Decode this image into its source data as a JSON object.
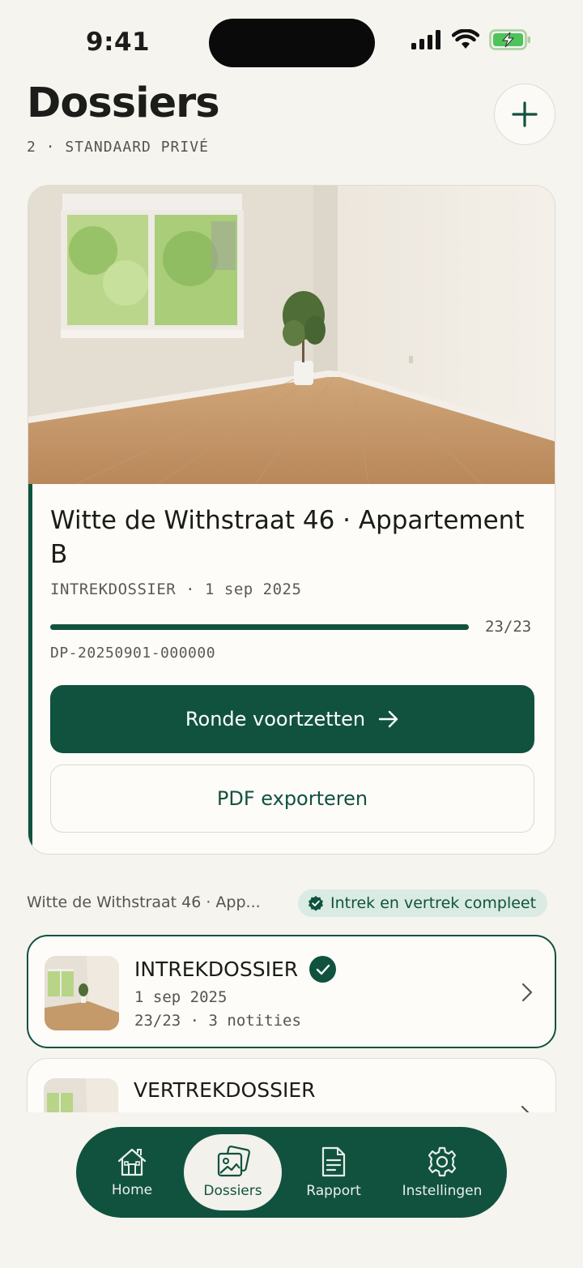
{
  "status_bar": {
    "time": "9:41"
  },
  "header": {
    "title": "Dossiers",
    "subtitle": "2 · STANDAARD PRIVÉ"
  },
  "main_card": {
    "title": "Witte de Withstraat 46 · Appartement B",
    "meta": "INTREKDOSSIER · 1 sep 2025",
    "progress_text": "23/23",
    "progress_fraction": 1.0,
    "reference": "DP-20250901-000000",
    "primary_action": "Ronde voortzetten",
    "secondary_action": "PDF exporteren"
  },
  "group": {
    "label": "Witte de Withstraat 46 · App...",
    "badge": "Intrek en vertrek compleet"
  },
  "dossiers": [
    {
      "title": "INTREKDOSSIER",
      "date": "1 sep 2025",
      "stats": "23/23 · 3 notities",
      "completed": true
    },
    {
      "title": "VERTREKDOSSIER"
    }
  ],
  "tabs": [
    {
      "label": "Home",
      "icon": "home-icon"
    },
    {
      "label": "Dossiers",
      "icon": "photos-icon",
      "active": true
    },
    {
      "label": "Rapport",
      "icon": "document-icon"
    },
    {
      "label": "Instellingen",
      "icon": "gear-icon"
    }
  ],
  "colors": {
    "accent": "#11523f",
    "background": "#f5f4ef",
    "badge_bg": "#d9ebe2"
  }
}
